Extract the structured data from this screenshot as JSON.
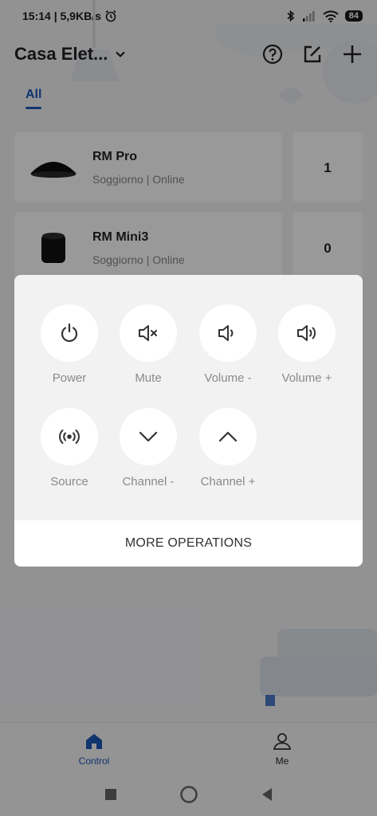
{
  "status_bar": {
    "time_info": "15:14 | 5,9KB/s",
    "battery": "84"
  },
  "header": {
    "home_name": "Casa Elet..."
  },
  "tabs": [
    {
      "label": "All"
    }
  ],
  "devices": [
    {
      "name": "RM Pro",
      "subtitle": "Soggiorno | Online",
      "count": "1"
    },
    {
      "name": "RM Mini3",
      "subtitle": "Soggiorno | Online",
      "count": "0"
    }
  ],
  "popup": {
    "operations": [
      {
        "label": "Power",
        "icon": "power-icon"
      },
      {
        "label": "Mute",
        "icon": "mute-icon"
      },
      {
        "label": "Volume -",
        "icon": "volume-down-icon"
      },
      {
        "label": "Volume +",
        "icon": "volume-up-icon"
      },
      {
        "label": "Source",
        "icon": "source-icon"
      },
      {
        "label": "Channel -",
        "icon": "chevron-down-icon"
      },
      {
        "label": "Channel +",
        "icon": "chevron-up-icon"
      }
    ],
    "more_label": "MORE OPERATIONS"
  },
  "bottom_nav": [
    {
      "label": "Control",
      "icon": "home-icon",
      "active": true
    },
    {
      "label": "Me",
      "icon": "person-icon",
      "active": false
    }
  ],
  "colors": {
    "accent": "#1b58b7",
    "label_gray": "#8a8a8a"
  }
}
